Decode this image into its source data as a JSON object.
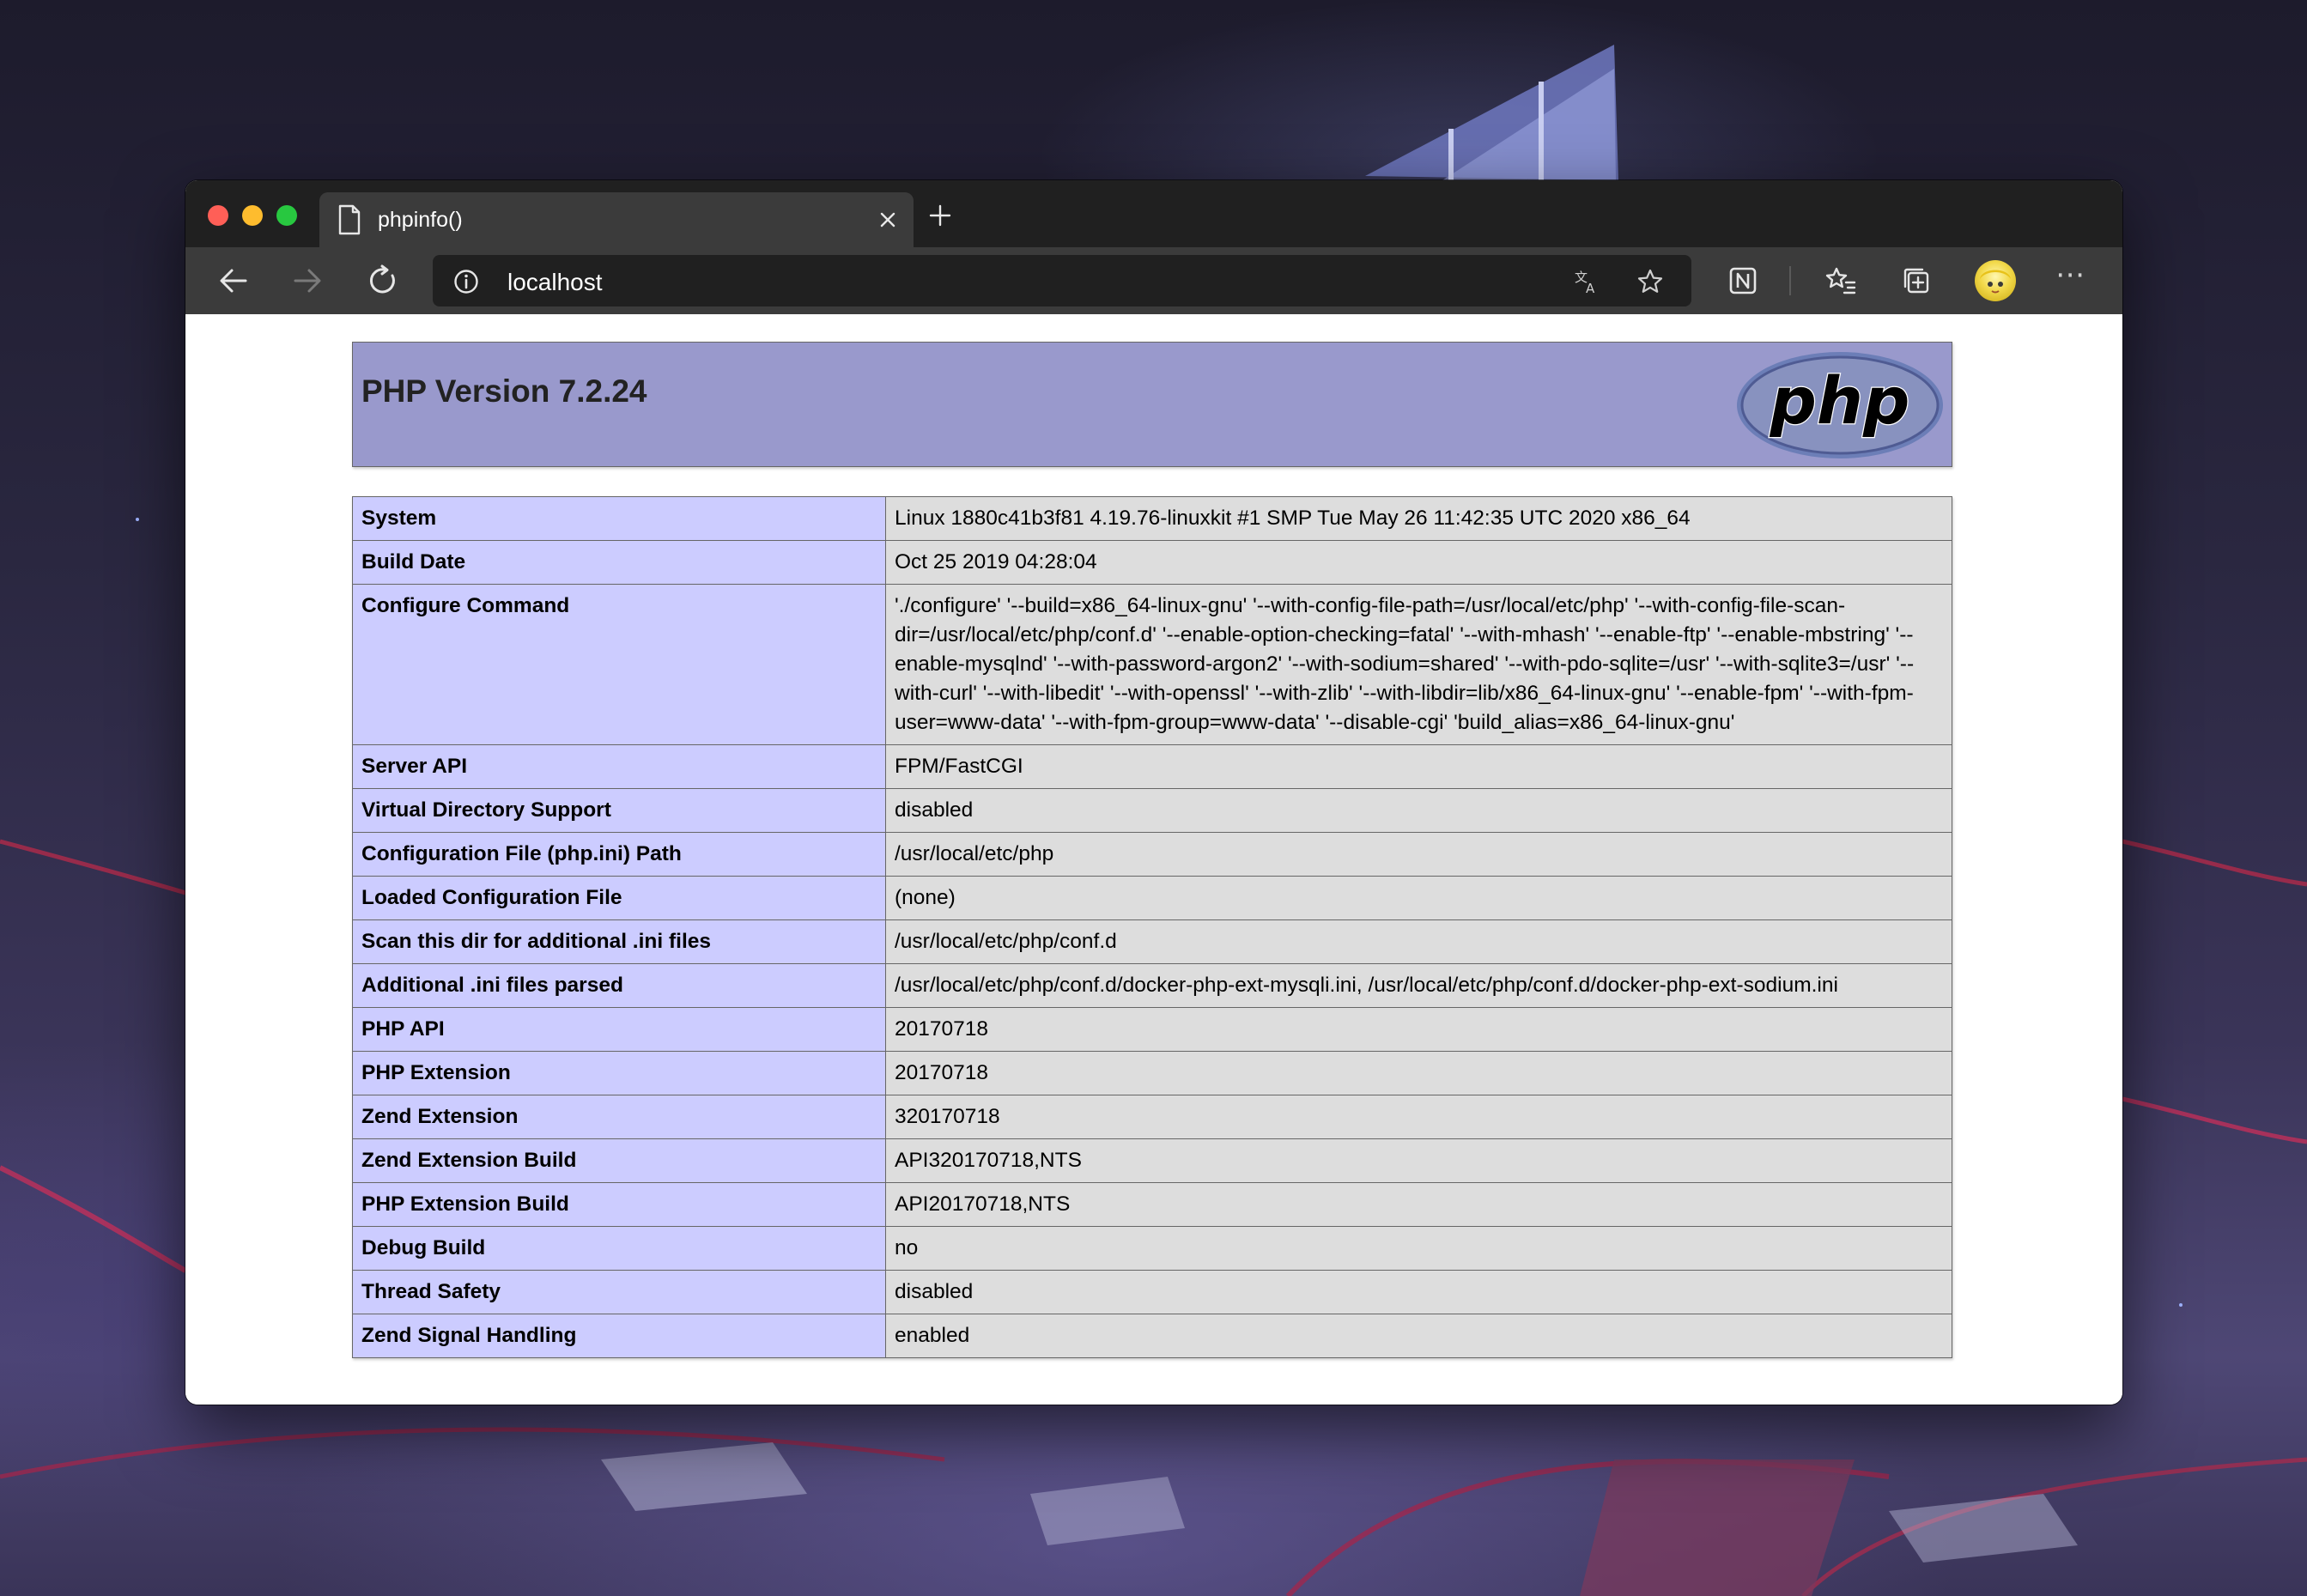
{
  "browser": {
    "tab": {
      "title": "phpinfo()"
    },
    "address_bar": {
      "url": "localhost"
    },
    "icons": {
      "tab_page": "page-icon",
      "tab_close": "close-icon",
      "new_tab": "plus-icon",
      "back": "back-arrow-icon",
      "forward": "forward-arrow-icon",
      "refresh": "refresh-icon",
      "site_info": "info-icon",
      "translate": "translate-icon",
      "favorite": "star-icon",
      "notion": "notion-icon",
      "favorites": "favorites-icon",
      "collections": "collections-icon",
      "profile": "avatar",
      "more": "more-icon"
    },
    "more_label": "⋯"
  },
  "page": {
    "title": "PHP Version 7.2.24",
    "logo_text": "php",
    "rows": [
      {
        "key": "System",
        "value": "Linux 1880c41b3f81 4.19.76-linuxkit #1 SMP Tue May 26 11:42:35 UTC 2020 x86_64"
      },
      {
        "key": "Build Date",
        "value": "Oct 25 2019 04:28:04"
      },
      {
        "key": "Configure Command",
        "value": "'./configure' '--build=x86_64-linux-gnu' '--with-config-file-path=/usr/local/etc/php' '--with-config-file-scan-dir=/usr/local/etc/php/conf.d' '--enable-option-checking=fatal' '--with-mhash' '--enable-ftp' '--enable-mbstring' '--enable-mysqlnd' '--with-password-argon2' '--with-sodium=shared' '--with-pdo-sqlite=/usr' '--with-sqlite3=/usr' '--with-curl' '--with-libedit' '--with-openssl' '--with-zlib' '--with-libdir=lib/x86_64-linux-gnu' '--enable-fpm' '--with-fpm-user=www-data' '--with-fpm-group=www-data' '--disable-cgi' 'build_alias=x86_64-linux-gnu'"
      },
      {
        "key": "Server API",
        "value": "FPM/FastCGI"
      },
      {
        "key": "Virtual Directory Support",
        "value": "disabled"
      },
      {
        "key": "Configuration File (php.ini) Path",
        "value": "/usr/local/etc/php"
      },
      {
        "key": "Loaded Configuration File",
        "value": "(none)"
      },
      {
        "key": "Scan this dir for additional .ini files",
        "value": "/usr/local/etc/php/conf.d"
      },
      {
        "key": "Additional .ini files parsed",
        "value": "/usr/local/etc/php/conf.d/docker-php-ext-mysqli.ini, /usr/local/etc/php/conf.d/docker-php-ext-sodium.ini"
      },
      {
        "key": "PHP API",
        "value": "20170718"
      },
      {
        "key": "PHP Extension",
        "value": "20170718"
      },
      {
        "key": "Zend Extension",
        "value": "320170718"
      },
      {
        "key": "Zend Extension Build",
        "value": "API320170718,NTS"
      },
      {
        "key": "PHP Extension Build",
        "value": "API20170718,NTS"
      },
      {
        "key": "Debug Build",
        "value": "no"
      },
      {
        "key": "Thread Safety",
        "value": "disabled"
      },
      {
        "key": "Zend Signal Handling",
        "value": "enabled"
      }
    ]
  }
}
